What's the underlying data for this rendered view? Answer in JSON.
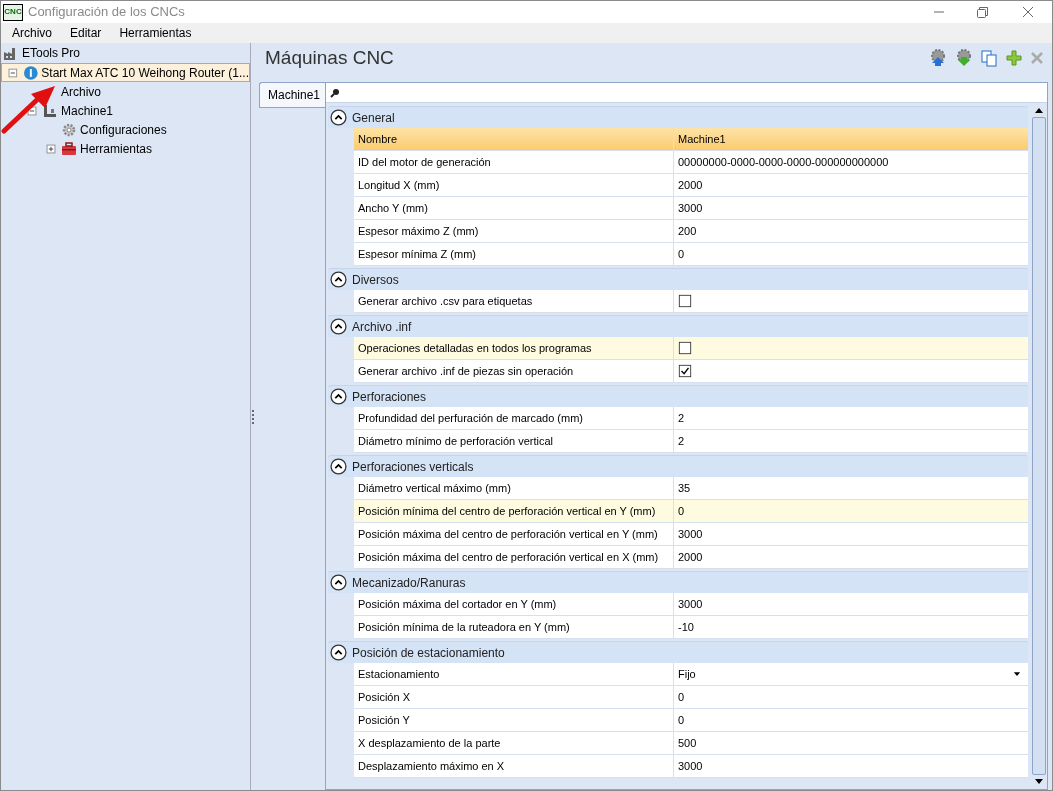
{
  "window": {
    "title": "Configuración de los CNCs",
    "icon_text": "CNC"
  },
  "menu": [
    "Archivo",
    "Editar",
    "Herramientas"
  ],
  "tree": {
    "label": "ETools Pro",
    "children": [
      {
        "label": "Start Max ATC 10 Weihong Router (1...",
        "kind": "machine-group",
        "selected": true,
        "expanded": true,
        "children": [
          {
            "label": "Archivo",
            "kind": "file",
            "selected": false
          },
          {
            "label": "Machine1",
            "kind": "machine",
            "selected": false,
            "expanded": true,
            "children": [
              {
                "label": "Configuraciones",
                "kind": "settings",
                "selected": false
              },
              {
                "label": "Herramientas",
                "kind": "toolbox",
                "selected": false,
                "expanded": false
              }
            ]
          }
        ]
      }
    ]
  },
  "panel": {
    "title": "Máquinas CNC",
    "tabs": [
      {
        "label": "Machine1",
        "selected": true
      }
    ]
  },
  "groups": [
    {
      "title": "General",
      "expanded": true,
      "rows": [
        {
          "name": "Nombre",
          "kind": "text",
          "value": "Machine1",
          "selected": true,
          "hovered": false
        },
        {
          "name": "ID del motor de generación",
          "kind": "text",
          "value": "00000000-0000-0000-0000-000000000000",
          "selected": false,
          "hovered": false
        },
        {
          "name": "Longitud X (mm)",
          "kind": "text",
          "value": "2000",
          "selected": false,
          "hovered": false
        },
        {
          "name": "Ancho Y (mm)",
          "kind": "text",
          "value": "3000",
          "selected": false,
          "hovered": false
        },
        {
          "name": "Espesor máximo Z (mm)",
          "kind": "text",
          "value": "200",
          "selected": false,
          "hovered": false
        },
        {
          "name": "Espesor mínima Z (mm)",
          "kind": "text",
          "value": "0",
          "selected": false,
          "hovered": false
        }
      ]
    },
    {
      "title": "Diversos",
      "expanded": true,
      "rows": [
        {
          "name": "Generar archivo .csv para etiquetas",
          "kind": "checkbox",
          "checked": false,
          "selected": false,
          "hovered": false
        }
      ]
    },
    {
      "title": "Archivo .inf",
      "expanded": true,
      "rows": [
        {
          "name": "Operaciones detalladas en todos los programas",
          "kind": "checkbox",
          "checked": false,
          "selected": false,
          "hovered": true
        },
        {
          "name": "Generar archivo .inf de piezas sin operación",
          "kind": "checkbox",
          "checked": true,
          "selected": false,
          "hovered": false
        }
      ]
    },
    {
      "title": "Perforaciones",
      "expanded": true,
      "rows": [
        {
          "name": "Profundidad del perfuración de marcado (mm)",
          "kind": "text",
          "value": "2",
          "selected": false,
          "hovered": false
        },
        {
          "name": "Diámetro mínimo de perforación vertical",
          "kind": "text",
          "value": "2",
          "selected": false,
          "hovered": false
        }
      ]
    },
    {
      "title": "Perforaciones verticals",
      "expanded": true,
      "rows": [
        {
          "name": "Diámetro vertical máximo (mm)",
          "kind": "text",
          "value": "35",
          "selected": false,
          "hovered": false
        },
        {
          "name": "Posición mínima del centro de perforación vertical en Y (mm)",
          "kind": "text",
          "value": "0",
          "selected": false,
          "hovered": true
        },
        {
          "name": "Posición máxima del centro de perforación vertical en Y (mm)",
          "kind": "text",
          "value": "3000",
          "selected": false,
          "hovered": false
        },
        {
          "name": "Posición máxima del centro de perforación vertical en X (mm)",
          "kind": "text",
          "value": "2000",
          "selected": false,
          "hovered": false
        }
      ]
    },
    {
      "title": "Mecanizado/Ranuras",
      "expanded": true,
      "rows": [
        {
          "name": "Posición máxima del cortador en Y (mm)",
          "kind": "text",
          "value": "3000",
          "selected": false,
          "hovered": false
        },
        {
          "name": "Posición mínima de la ruteadora en Y (mm)",
          "kind": "text",
          "value": "-10",
          "selected": false,
          "hovered": false
        }
      ]
    },
    {
      "title": "Posición de estacionamiento",
      "expanded": true,
      "rows": [
        {
          "name": "Estacionamiento",
          "kind": "dropdown",
          "value": "Fijo",
          "selected": false,
          "hovered": false
        },
        {
          "name": "Posición X",
          "kind": "text",
          "value": "0",
          "selected": false,
          "hovered": false
        },
        {
          "name": "Posición Y",
          "kind": "text",
          "value": "0",
          "selected": false,
          "hovered": false
        },
        {
          "name": "X desplazamiento de la parte",
          "kind": "text",
          "value": "500",
          "selected": false,
          "hovered": false
        },
        {
          "name": "Desplazamiento máximo en X",
          "kind": "text",
          "value": "3000",
          "selected": false,
          "hovered": false
        }
      ]
    }
  ]
}
